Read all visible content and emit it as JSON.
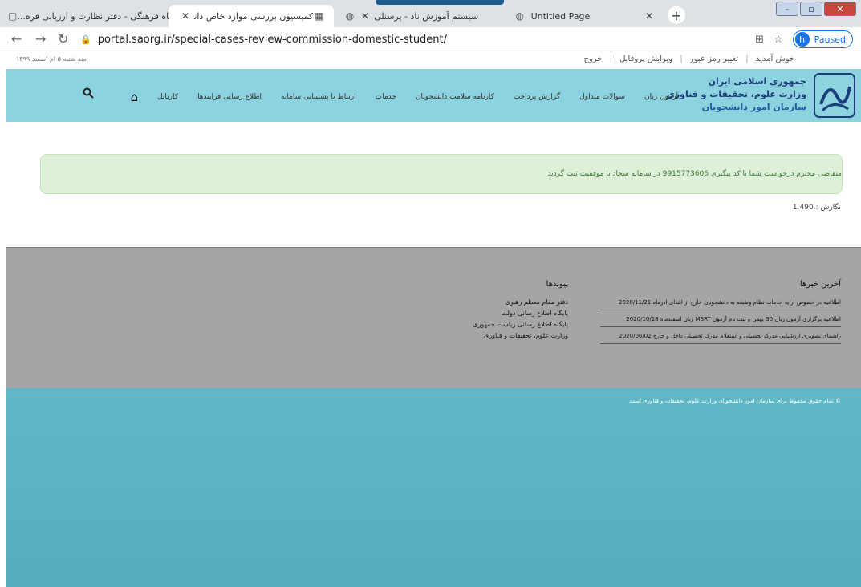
{
  "browser": {
    "tabs": [
      {
        "title": "درگاه فرهنگی - دفتر نظارت و ارزیابی فره...",
        "close": "✕",
        "active": false
      },
      {
        "title": "کمیسیون بررسی موارد خاص دانشجویان دا...",
        "close": "✕",
        "active": true
      },
      {
        "title": "سیستم آموزش ناد - پرسنلی",
        "close": "✕",
        "active": false
      },
      {
        "title": "Untitled Page",
        "close": "✕",
        "active": false
      }
    ],
    "new_tab": "+",
    "url": "portal.saorg.ir/special-cases-review-commission-domestic-student/",
    "profile_initial": "h",
    "profile_status": "Paused"
  },
  "userbar": {
    "date": "سه شنبه ۵ ام اسفند ۱۳۹۹",
    "welcome": "خوش آمدید",
    "change_password": "تغییر رمز عبور",
    "edit_profile": "ویرایش پروفایل",
    "logout": "خروج"
  },
  "logo": {
    "emblem": "شاهد",
    "line1": "جمهوری اسلامی ایران",
    "line2": "وزارت علوم، تحقیقات و فناوری",
    "line3": "سازمان امور دانشجویان"
  },
  "menu": [
    "کارتابل",
    "اطلاع رسانی فرایندها",
    "ارتباط با پشتیبانی سامانه",
    "خدمات",
    "کارنامه سلامت دانشجویان",
    "گزارش پرداخت",
    "سوالات متداول",
    "آزمون زبان"
  ],
  "alert": {
    "message": "متقاضی محترم درخواست شما با کد پیگیری 9915773606 در سامانه سجاد با موفقیت ثبت گردید"
  },
  "version": "نگارش : 1.490",
  "footer": {
    "news_title": "آخرین خبرها",
    "news": [
      "اطلاعیه در خصوص ارایه خدمات نظام وظیفه به دانشجویان خارج از ابتدای اذرماه 2020/11/21",
      "اطلاعیه برگزاری آزمون زبان 30 بهمن و ثبت نام آزمون MSRT زبان اسفندماه 2020/10/18",
      "راهنمای تصویری ارزشیابی مدرک تحصیلی و استعلام مدرک تحصیلی داخل و خارج 2020/06/02"
    ],
    "links_title": "پیوندها",
    "links": [
      "دفتر مقام معظم رهبری",
      "پایگاه اطلاع رسانی دولت",
      "پایگاه اطلاع رسانی ریاست جمهوری",
      "وزارت علوم، تحقیقات و فناوری"
    ],
    "copyright": "© تمام حقوق محفوظ برای سازمان امور دانشجویان وزارت علوم، تحقیقات و فناوری است"
  }
}
